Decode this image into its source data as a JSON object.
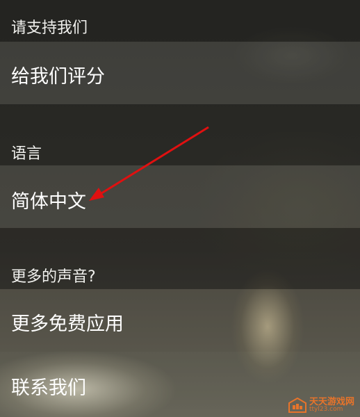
{
  "sections": {
    "support_header": "请支持我们",
    "rate_us": "给我们评分",
    "language_header": "语言",
    "language_value": "简体中文",
    "more_sounds_header": "更多的声音?",
    "more_free_apps": "更多免费应用",
    "contact_us": "联系我们"
  },
  "annotation": {
    "arrow_color": "#e01010"
  },
  "watermark": {
    "name": "天天游戏网",
    "url": "ttyl23.com",
    "color": "#e8742a"
  }
}
